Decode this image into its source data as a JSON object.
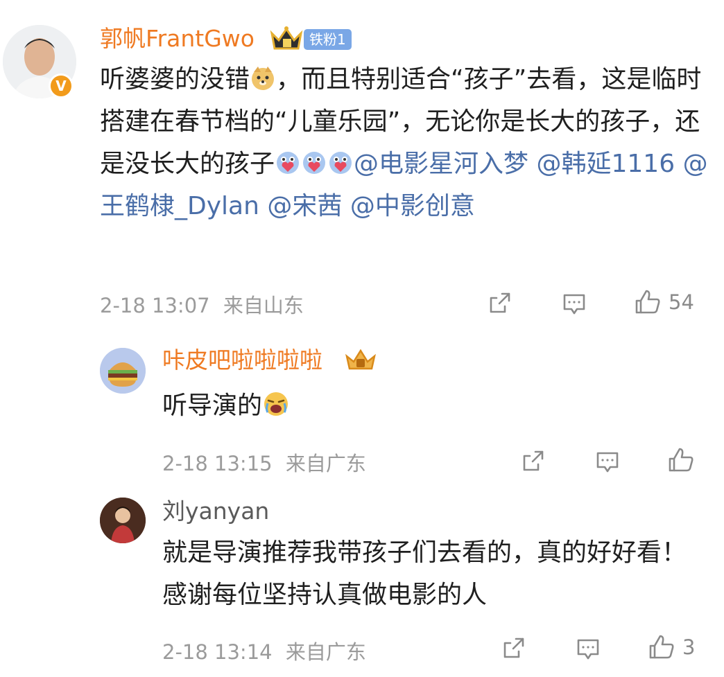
{
  "comments": [
    {
      "author": "郭帆FrantGwo",
      "badge_label": "铁粉1",
      "text_parts": [
        "听婆婆的没错",
        "，而且特别适合“孩子”去看，这是临时搭建在春节档的“儿童乐园”，无论你是长大的孩子，还是没长大的孩子",
        "@电影星河入梦",
        "@韩延1116",
        "@王鹤棣_Dylan",
        "@宋茜",
        "@中影创意"
      ],
      "time": "2-18 13:07",
      "location": "来自山东",
      "likes": "54",
      "verified_badge": "V"
    },
    {
      "author": "咔皮吧啦啦啦啦",
      "text": "听导演的",
      "time": "2-18 13:15",
      "location": "来自广东",
      "likes": ""
    },
    {
      "author": "刘yanyan",
      "text": "就是导演推荐我带孩子们去看的，真的好好看！感谢每位坚持认真做电影的人",
      "time": "2-18 13:14",
      "location": "来自广东",
      "likes": "3"
    }
  ],
  "icons": {
    "share": "share-icon",
    "comment": "comment-icon",
    "like": "like-icon",
    "crown": "crown-icon",
    "doge": "doge-emoji",
    "love": "love-emoji",
    "cry": "cry-emoji"
  },
  "colors": {
    "author_orange": "#ef7a22",
    "mention_blue": "#4a6ea8",
    "meta_gray": "#9b9b9b",
    "badge_blue": "#7aa7e6"
  }
}
